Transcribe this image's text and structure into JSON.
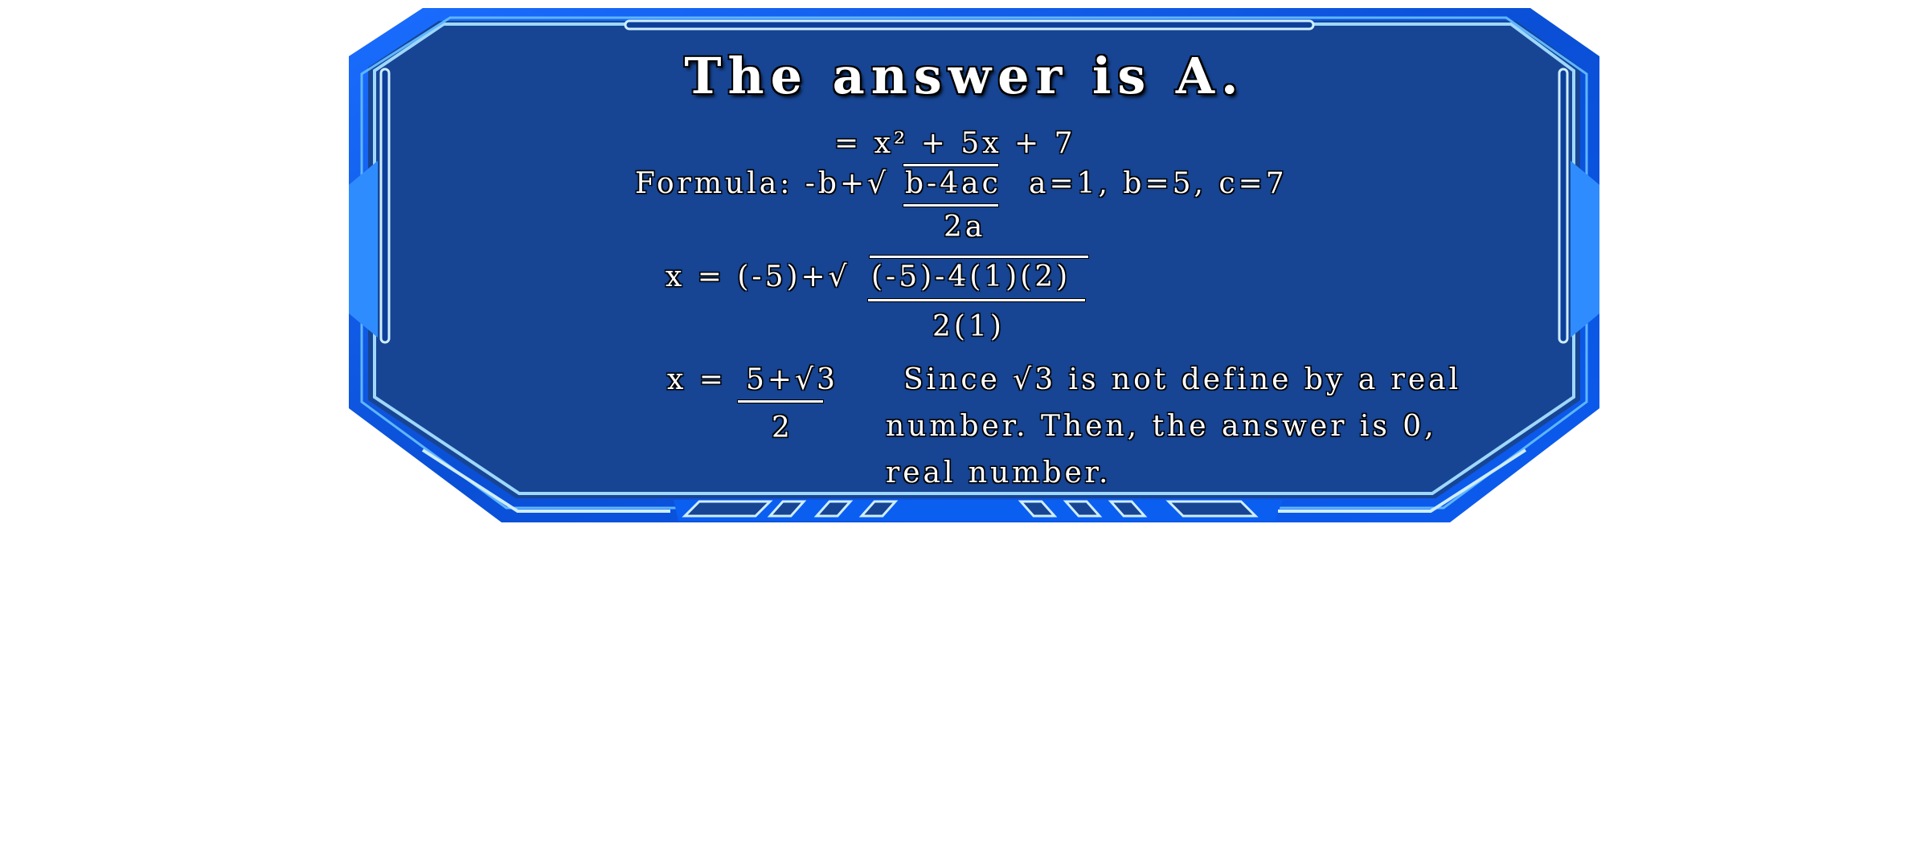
{
  "title": "The answer is A.",
  "step_equation": "= x² + 5x + 7",
  "formula": {
    "label": "Formula: -b+√",
    "radicand": "b-4ac",
    "denominator": "2a",
    "coefficients": "a=1, b=5, c=7"
  },
  "substitution": {
    "lhs": "x = (-5)+√",
    "radicand": "(-5)-4(1)(2)",
    "denominator": "2(1)"
  },
  "result": {
    "lhs": "x =",
    "numerator": "5+√3",
    "denominator": "2"
  },
  "explanation": {
    "line1": "Since √3 is not define by a real",
    "line2": "number. Then, the answer is 0,",
    "line3": "real number."
  },
  "colors": {
    "panel_fill": "#174593",
    "frame_blue": "#0a5ff0",
    "frame_glow": "#7ec8ff",
    "page_background": "#ffffff"
  }
}
